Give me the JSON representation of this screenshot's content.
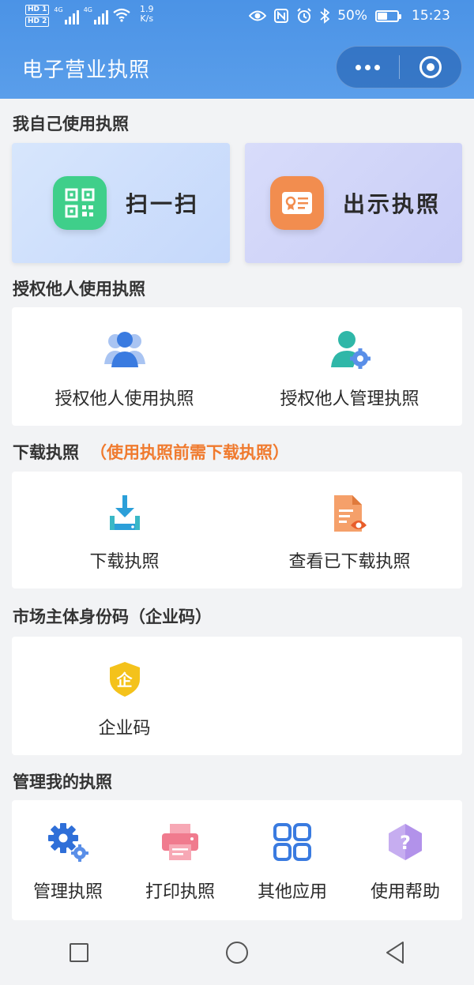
{
  "status_bar": {
    "sim1": "HD 1",
    "sim2": "HD 2",
    "net1": "4G",
    "net2": "4G",
    "speed_value": "1.9",
    "speed_unit": "K/s",
    "battery": "50%",
    "time": "15:23"
  },
  "header": {
    "title": "电子营业执照"
  },
  "sections": {
    "self_use": {
      "title": "我自己使用执照",
      "scan_label": "扫一扫",
      "show_label": "出示执照"
    },
    "authorize": {
      "title": "授权他人使用执照",
      "use_label": "授权他人使用执照",
      "manage_label": "授权他人管理执照"
    },
    "download": {
      "title": "下载执照",
      "note": "（使用执照前需下载执照）",
      "download_label": "下载执照",
      "view_label": "查看已下载执照"
    },
    "entity_code": {
      "title": "市场主体身份码（企业码）",
      "code_label": "企业码",
      "badge_char": "企"
    },
    "manage": {
      "title": "管理我的执照",
      "items": [
        {
          "label": "管理执照",
          "icon": "gear-icon"
        },
        {
          "label": "打印执照",
          "icon": "printer-icon"
        },
        {
          "label": "其他应用",
          "icon": "grid-icon"
        },
        {
          "label": "使用帮助",
          "icon": "help-icon"
        }
      ]
    }
  },
  "colors": {
    "header_blue": "#4b93e6",
    "accent_orange": "#f07a2e",
    "scan_green": "#3fcf8a",
    "license_orange": "#f28d4f",
    "icon_blue": "#3a7be0",
    "help_purple": "#b89be8",
    "printer_pink": "#f07b8e",
    "badge_yellow": "#f4c21b"
  }
}
